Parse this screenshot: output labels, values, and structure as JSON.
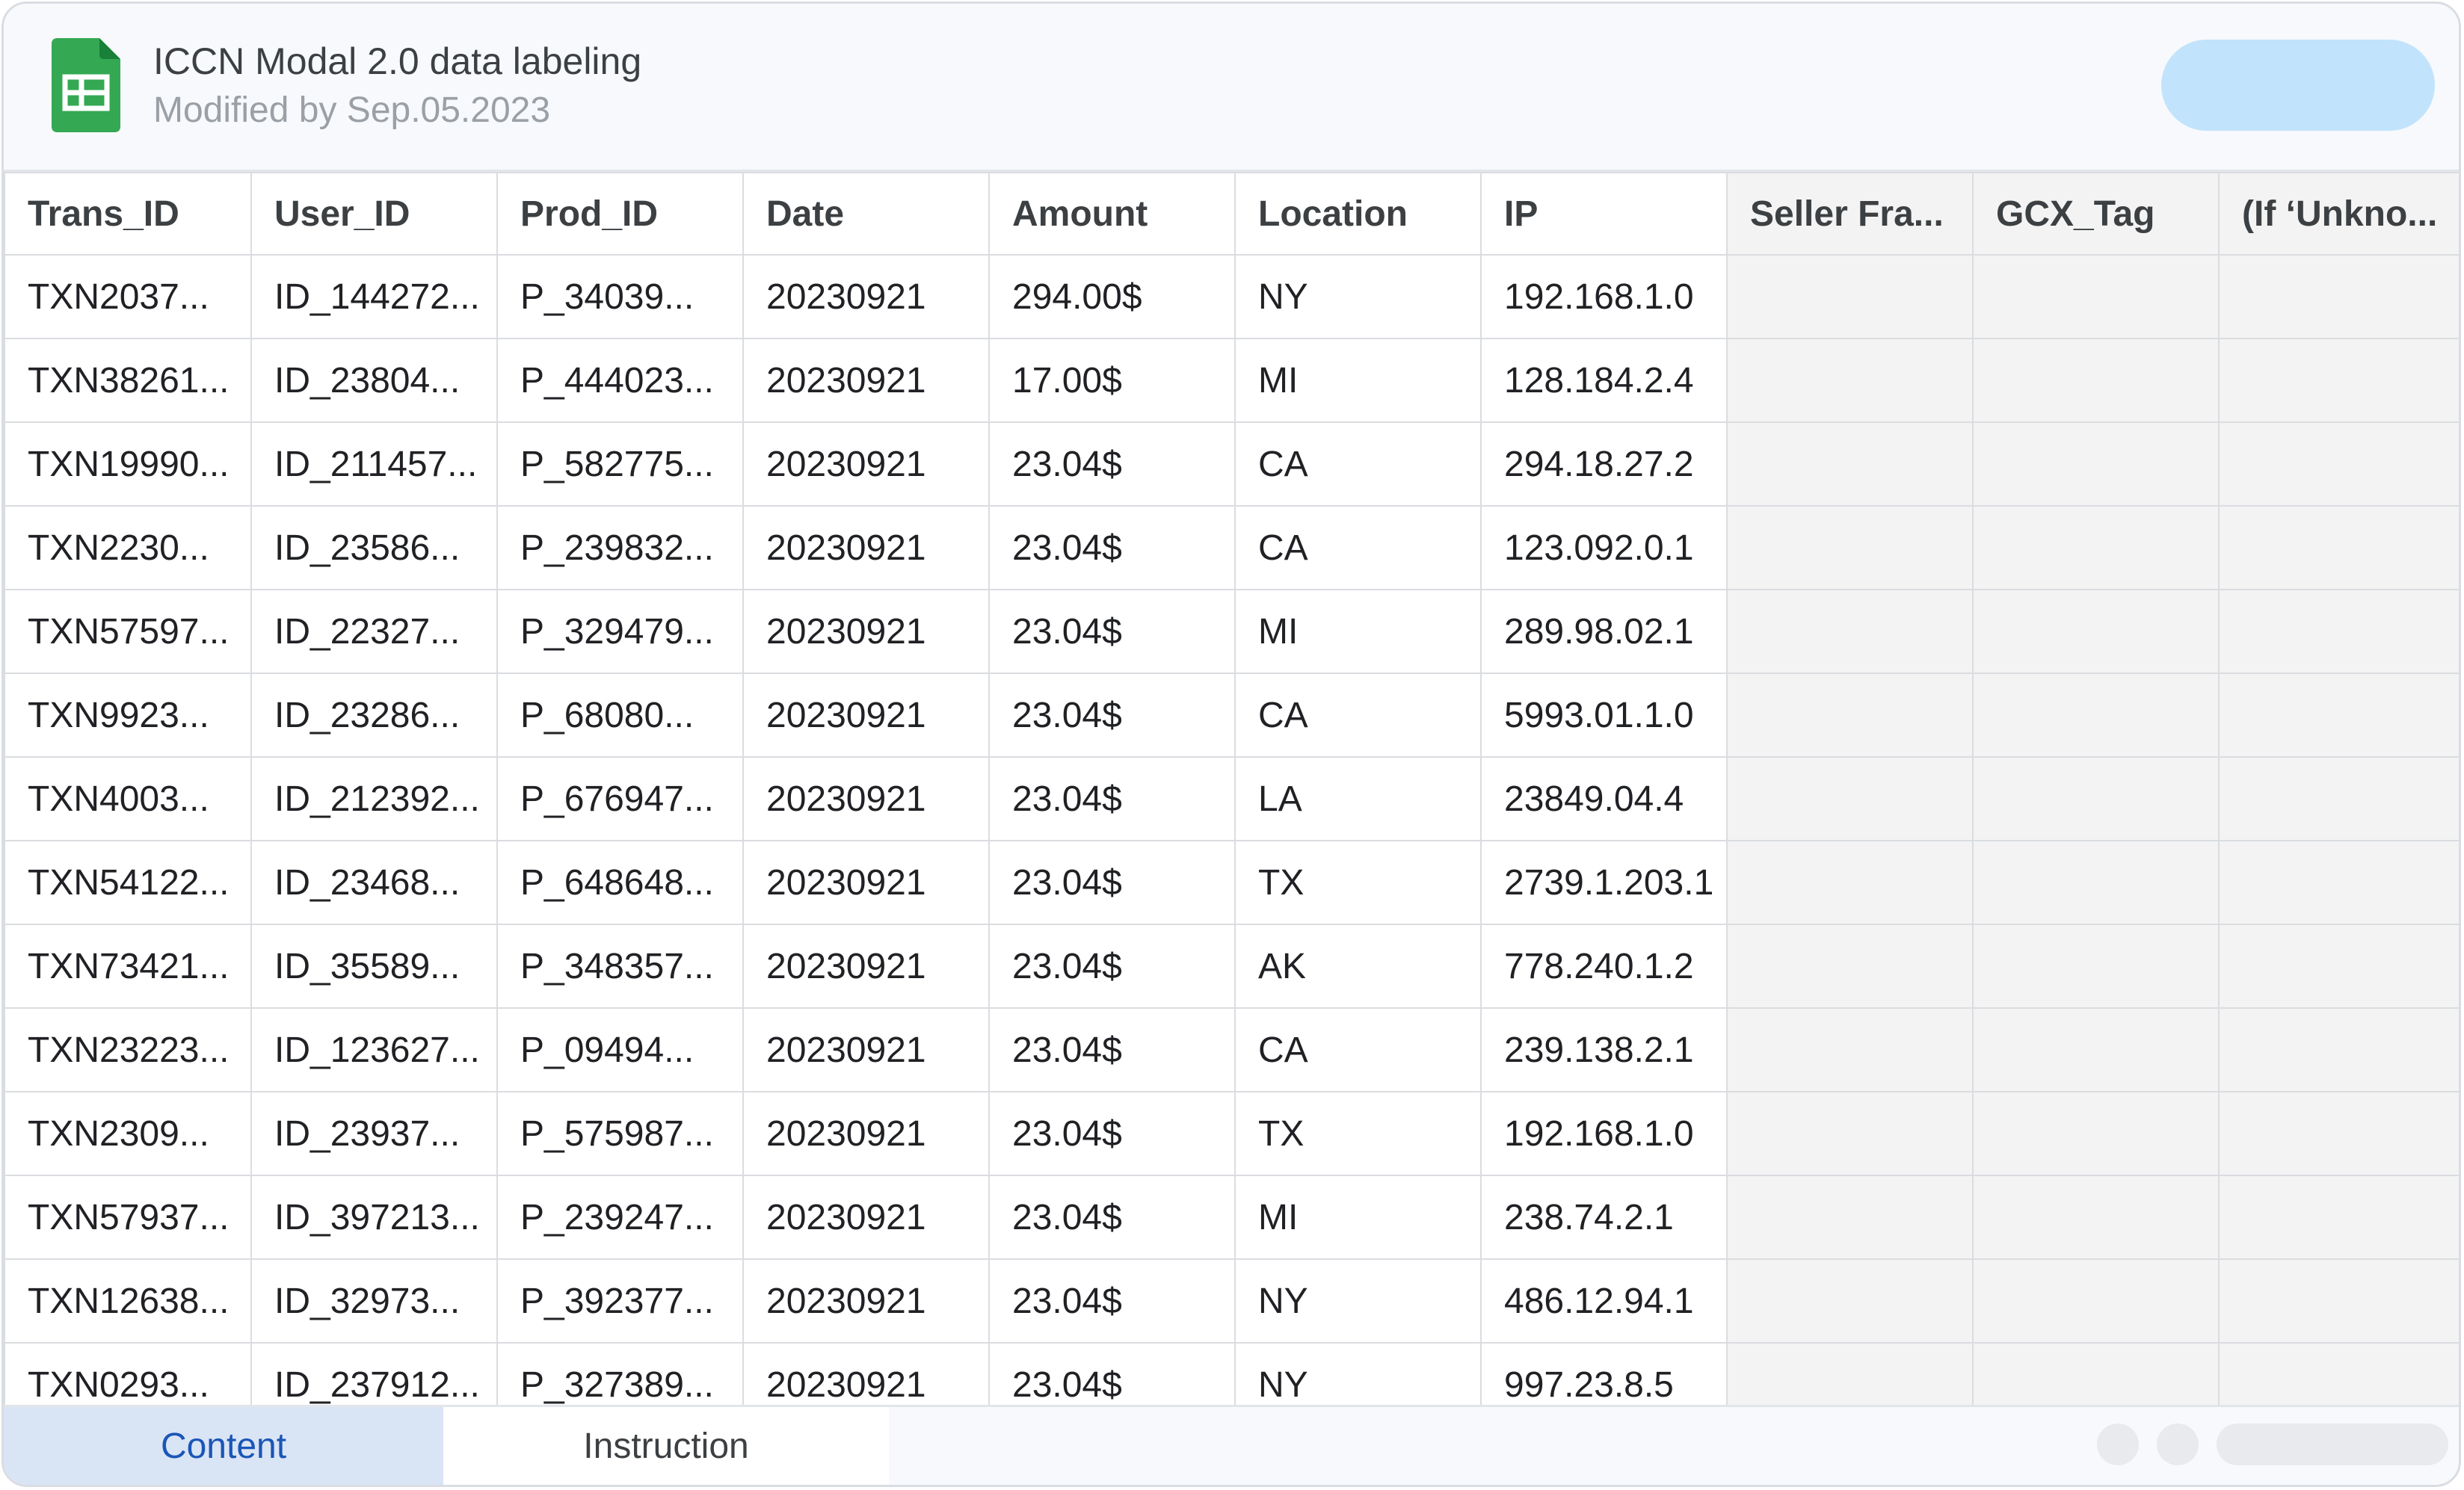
{
  "header": {
    "title": "ICCN Modal 2.0 data labeling",
    "subtitle": "Modified by Sep.05.2023",
    "icon": "google-sheets-icon",
    "share_button_color": "#c2e3fc"
  },
  "table": {
    "columns": [
      "Trans_ID",
      "User_ID",
      "Prod_ID",
      "Date",
      "Amount",
      "Location",
      "IP",
      "Seller Fra...",
      "GCX_Tag",
      "(If ‘Unkno..."
    ],
    "rows": [
      [
        "TXN2037...",
        "ID_144272...",
        "P_34039...",
        "20230921",
        "294.00$",
        "NY",
        "192.168.1.0",
        "",
        "",
        ""
      ],
      [
        "TXN38261...",
        "ID_23804...",
        "P_444023...",
        "20230921",
        "17.00$",
        "MI",
        "128.184.2.4",
        "",
        "",
        ""
      ],
      [
        "TXN19990...",
        "ID_211457...",
        "P_582775...",
        "20230921",
        "23.04$",
        "CA",
        "294.18.27.2",
        "",
        "",
        ""
      ],
      [
        "TXN2230...",
        "ID_23586...",
        "P_239832...",
        "20230921",
        "23.04$",
        "CA",
        "123.092.0.1",
        "",
        "",
        ""
      ],
      [
        "TXN57597...",
        "ID_22327...",
        "P_329479...",
        "20230921",
        "23.04$",
        "MI",
        "289.98.02.1",
        "",
        "",
        ""
      ],
      [
        "TXN9923...",
        "ID_23286...",
        "P_68080...",
        "20230921",
        "23.04$",
        "CA",
        "5993.01.1.0",
        "",
        "",
        ""
      ],
      [
        "TXN4003...",
        "ID_212392...",
        "P_676947...",
        "20230921",
        "23.04$",
        "LA",
        "23849.04.4",
        "",
        "",
        ""
      ],
      [
        "TXN54122...",
        "ID_23468...",
        "P_648648...",
        "20230921",
        "23.04$",
        "TX",
        "2739.1.203.1",
        "",
        "",
        ""
      ],
      [
        "TXN73421...",
        "ID_35589...",
        "P_348357...",
        "20230921",
        "23.04$",
        "AK",
        "778.240.1.2",
        "",
        "",
        ""
      ],
      [
        "TXN23223...",
        "ID_123627...",
        "P_09494...",
        "20230921",
        "23.04$",
        "CA",
        "239.138.2.1",
        "",
        "",
        ""
      ],
      [
        "TXN2309...",
        "ID_23937...",
        "P_575987...",
        "20230921",
        "23.04$",
        "TX",
        "192.168.1.0",
        "",
        "",
        ""
      ],
      [
        "TXN57937...",
        "ID_397213...",
        "P_239247...",
        "20230921",
        "23.04$",
        "MI",
        "238.74.2.1",
        "",
        "",
        ""
      ],
      [
        "TXN12638...",
        "ID_32973...",
        "P_392377...",
        "20230921",
        "23.04$",
        "NY",
        "486.12.94.1",
        "",
        "",
        ""
      ],
      [
        "TXN0293...",
        "ID_237912...",
        "P_327389...",
        "20230921",
        "23.04$",
        "NY",
        "997.23.8.5",
        "",
        "",
        ""
      ]
    ]
  },
  "footer": {
    "tabs": [
      {
        "label": "Content",
        "active": true
      },
      {
        "label": "Instruction",
        "active": false
      }
    ],
    "active_tab_color": "#1a56b5"
  }
}
